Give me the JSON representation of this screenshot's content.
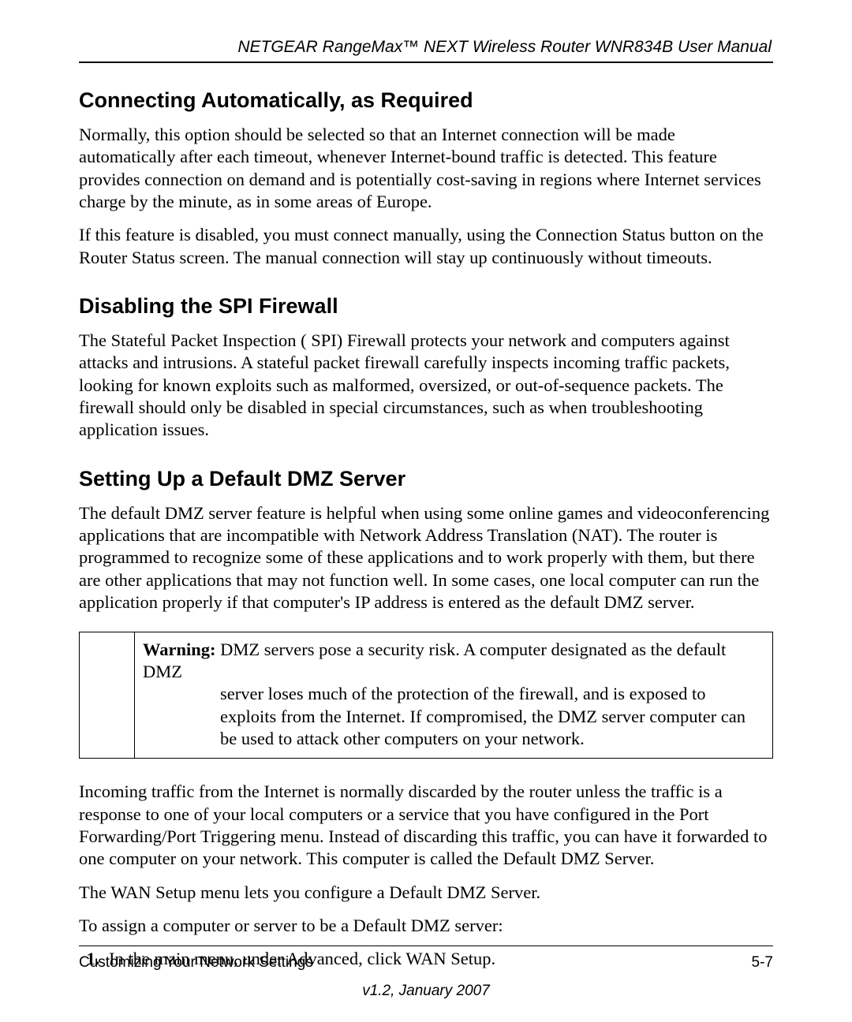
{
  "header": {
    "running_title": "NETGEAR RangeMax™ NEXT Wireless Router WNR834B User Manual"
  },
  "sections": {
    "s1": {
      "title": "Connecting Automatically, as Required",
      "p1": "Normally, this option should be selected so that an Internet connection will be made automatically after each timeout, whenever Internet-bound traffic is detected. This feature provides connection on demand and is potentially cost-saving in regions where Internet services charge by the minute, as in some areas of Europe.",
      "p2": "If this feature is disabled, you must connect manually, using the Connection Status button on the Router Status screen. The manual connection will stay up continuously without timeouts."
    },
    "s2": {
      "title": "Disabling the SPI Firewall",
      "p1": "The Stateful Packet Inspection ( SPI) Firewall protects your network and computers against attacks and intrusions. A stateful packet firewall carefully inspects incoming traffic packets, looking for known exploits such as malformed, oversized, or out-of-sequence packets. The firewall should only be disabled in special circumstances, such as when troubleshooting application issues."
    },
    "s3": {
      "title": "Setting Up a Default DMZ Server",
      "p1": "The default DMZ server feature is helpful when using some online games and videoconferencing applications that are incompatible with Network Address Translation (NAT). The router is programmed to recognize some of these applications and to work properly with them, but there are other applications that may not function well. In some cases, one local computer can run the application properly if that computer's IP address is entered as the default DMZ server.",
      "warning_label": "Warning:",
      "warning_first": " DMZ servers pose a security risk. A computer designated as the default DMZ",
      "warning_rest": "server loses much of the protection of the firewall, and is exposed to exploits from the Internet. If compromised, the DMZ server computer can be used to attack other computers on your network.",
      "p2": "Incoming traffic from the Internet is normally discarded by the router unless the traffic is a response to one of your local computers or a service that you have configured in the Port Forwarding/Port Triggering menu. Instead of discarding this traffic, you can have it forwarded to one computer on your network. This computer is called the Default DMZ Server.",
      "p3": "The WAN Setup menu lets you configure a Default DMZ Server.",
      "p4": "To assign a computer or server to be a Default DMZ server:",
      "step1": "In the main menu, under Advanced, click WAN Setup."
    }
  },
  "footer": {
    "left": "Customizing Your Network Settings",
    "right": "5-7",
    "version": "v1.2, January 2007"
  }
}
